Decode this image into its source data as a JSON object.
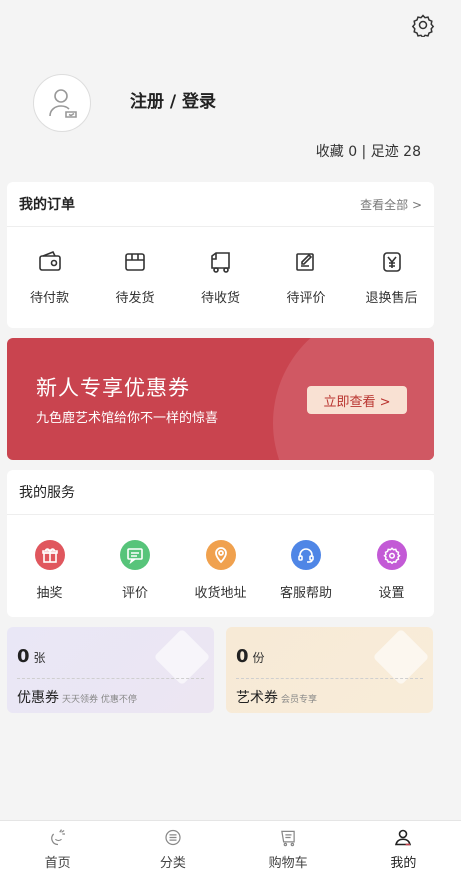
{
  "header": {
    "login_label": "注册 / 登录",
    "stats": "收藏 0 | 足迹 28"
  },
  "orders": {
    "title": "我的订单",
    "view_all": "查看全部 >",
    "items": [
      {
        "label": "待付款",
        "icon": "wallet-icon"
      },
      {
        "label": "待发货",
        "icon": "box-icon"
      },
      {
        "label": "待收货",
        "icon": "truck-icon"
      },
      {
        "label": "待评价",
        "icon": "review-edit-icon"
      },
      {
        "label": "退换售后",
        "icon": "refund-yen-icon"
      }
    ]
  },
  "banner": {
    "title": "新人专享优惠券",
    "subtitle": "九色鹿艺术馆给你不一样的惊喜",
    "button": "立即查看 >",
    "bg_color": "#c9444f"
  },
  "services": {
    "title": "我的服务",
    "items": [
      {
        "label": "抽奖",
        "icon": "gift-icon",
        "color": "#e0575e"
      },
      {
        "label": "评价",
        "icon": "chat-icon",
        "color": "#57c47a"
      },
      {
        "label": "收货地址",
        "icon": "location-icon",
        "color": "#f0a14e"
      },
      {
        "label": "客服帮助",
        "icon": "headset-icon",
        "color": "#4f86e6"
      },
      {
        "label": "设置",
        "icon": "gear-icon",
        "color": "#c35ad6"
      }
    ]
  },
  "coupons": [
    {
      "count": "0",
      "unit": "张",
      "name": "优惠券",
      "desc": "天天领券 优惠不停"
    },
    {
      "count": "0",
      "unit": "份",
      "name": "艺术券",
      "desc": "会员专享"
    }
  ],
  "tabbar": [
    {
      "label": "首页",
      "icon": "home-deer-icon"
    },
    {
      "label": "分类",
      "icon": "category-icon"
    },
    {
      "label": "购物车",
      "icon": "cart-icon"
    },
    {
      "label": "我的",
      "icon": "user-icon",
      "active": true
    }
  ]
}
